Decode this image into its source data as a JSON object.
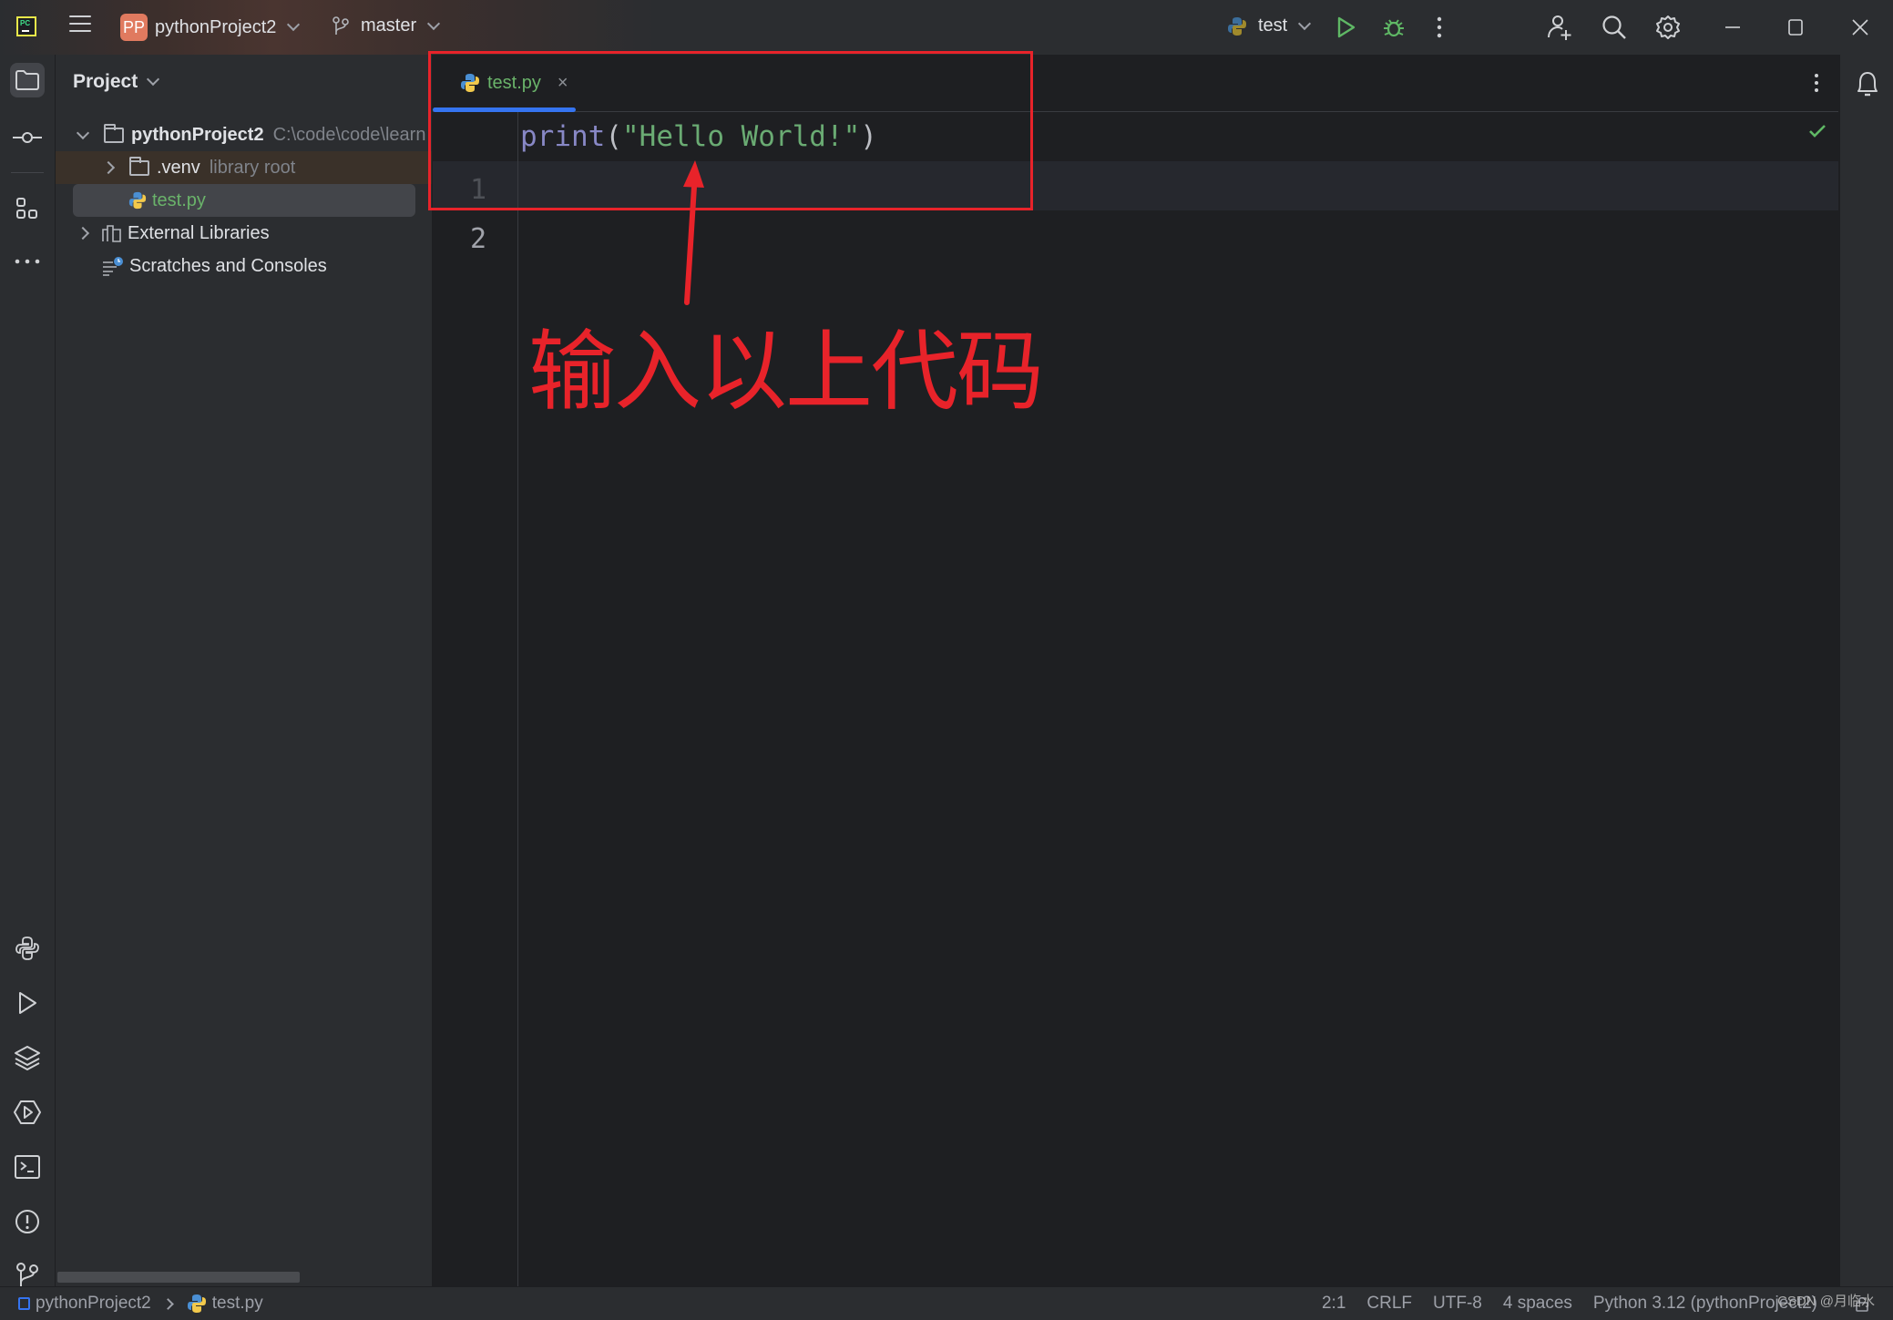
{
  "titlebar": {
    "app_logo": "PC",
    "project_badge": "PP",
    "project_name": "pythonProject2",
    "branch": "master",
    "run_config": "test",
    "icons": [
      "main-menu-icon",
      "branch-icon",
      "python-icon",
      "run-icon",
      "debug-icon",
      "more-vertical-icon",
      "add-user-icon",
      "search-icon",
      "settings-icon",
      "minimize-icon",
      "maximize-icon",
      "close-icon"
    ]
  },
  "left_strip": {
    "top_icons": [
      "project-folder-icon",
      "commit-icon",
      "structure-icon",
      "more-horizontal-icon"
    ],
    "bottom_icons": [
      "python-console-icon",
      "run-icon",
      "layers-icon",
      "services-icon",
      "terminal-icon",
      "problems-icon",
      "git-icon"
    ]
  },
  "project_panel": {
    "title": "Project",
    "tree": [
      {
        "label": "pythonProject2",
        "hint": "C:\\code\\code\\learn",
        "expanded": true,
        "bold": true
      },
      {
        "label": ".venv",
        "hint": "library root",
        "expanded": false
      },
      {
        "label": "test.py",
        "selected": true
      },
      {
        "label": "External Libraries",
        "expanded": false
      },
      {
        "label": "Scratches and Consoles"
      }
    ]
  },
  "editor": {
    "tab": {
      "label": "test.py",
      "close": "×"
    },
    "lines": [
      {
        "number": "1",
        "tokens": [
          {
            "t": "fn",
            "v": "print"
          },
          {
            "t": "punc",
            "v": "("
          },
          {
            "t": "str",
            "v": "\"Hello World!\""
          },
          {
            "t": "punc",
            "v": ")"
          }
        ]
      },
      {
        "number": "2",
        "tokens": []
      }
    ],
    "inspection_status": "ok"
  },
  "annotation": {
    "text": "输入以上代码",
    "color": "#e8232a"
  },
  "statusbar": {
    "breadcrumb": [
      "pythonProject2",
      "test.py"
    ],
    "position": "2:1",
    "line_separator": "CRLF",
    "encoding": "UTF-8",
    "indent": "4 spaces",
    "interpreter": "Python 3.12 (pythonProject2)"
  },
  "watermark": "CSDN @月临水",
  "colors": {
    "accent": "#3574f0",
    "string": "#6aab73",
    "function": "#8888c6",
    "run_green": "#5fb865",
    "badge": "#e07a5f"
  }
}
